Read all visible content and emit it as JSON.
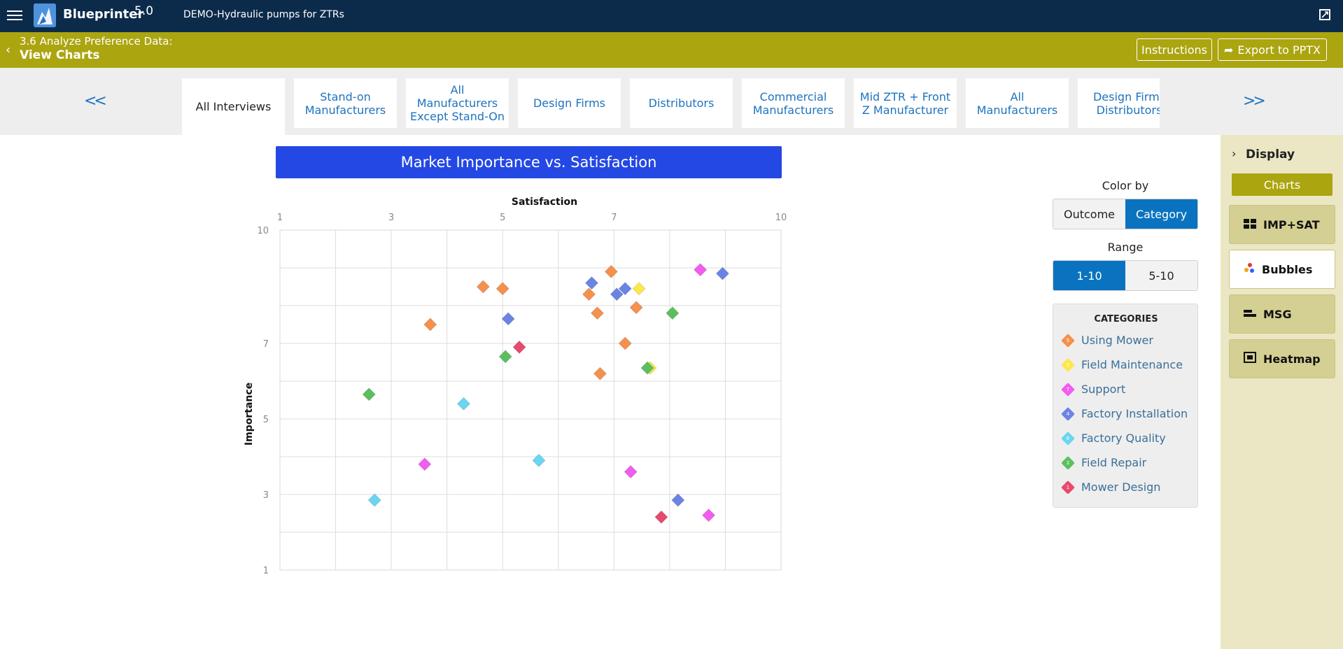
{
  "app": {
    "brand": "Blueprinter",
    "version": "5.0",
    "project": "DEMO-Hydraulic pumps for ZTRs"
  },
  "subheader": {
    "step": "3.6 Analyze Preference Data:",
    "title": "View Charts",
    "instructions_label": "Instructions",
    "export_label": "Export to PPTX"
  },
  "tabs": {
    "prev": "<<",
    "next": ">>",
    "items": [
      {
        "label": "All Interviews",
        "active": true
      },
      {
        "label": "Stand-on Manufacturers",
        "active": false
      },
      {
        "label": "All Manufacturers Except Stand-On",
        "active": false
      },
      {
        "label": "Design Firms",
        "active": false
      },
      {
        "label": "Distributors",
        "active": false
      },
      {
        "label": "Commercial Manufacturers",
        "active": false
      },
      {
        "label": "Mid ZTR + Front Z Manufacturer",
        "active": false
      },
      {
        "label": "All Manufacturers",
        "active": false
      },
      {
        "label": "Design Firms Distributors",
        "active": false
      }
    ]
  },
  "controls": {
    "color_by_label": "Color by",
    "color_by_options": [
      "Outcome",
      "Category"
    ],
    "color_by_selected": "Category",
    "range_label": "Range",
    "range_options": [
      "1-10",
      "5-10"
    ],
    "range_selected": "1-10",
    "categories_heading": "CATEGORIES"
  },
  "categories": [
    {
      "num": "5",
      "name": "Using Mower",
      "color": "#f5904d"
    },
    {
      "num": "3",
      "name": "Field Maintenance",
      "color": "#fde84a"
    },
    {
      "num": "7",
      "name": "Support",
      "color": "#f25cf0"
    },
    {
      "num": "4",
      "name": "Factory Installation",
      "color": "#6b84e4"
    },
    {
      "num": "6",
      "name": "Factory Quality",
      "color": "#6ad6f2"
    },
    {
      "num": "2",
      "name": "Field Repair",
      "color": "#5cbf5f"
    },
    {
      "num": "1",
      "name": "Mower Design",
      "color": "#e84a6e"
    }
  ],
  "sidebar": {
    "display_label": "Display",
    "charts_label": "Charts",
    "buttons": [
      {
        "label": "IMP+SAT",
        "icon": "imp-sat-icon",
        "selected": false
      },
      {
        "label": "Bubbles",
        "icon": "bubbles-icon",
        "selected": true
      },
      {
        "label": "MSG",
        "icon": "msg-icon",
        "selected": false
      },
      {
        "label": "Heatmap",
        "icon": "heatmap-icon",
        "selected": false
      }
    ]
  },
  "chart_data": {
    "type": "scatter",
    "title": "Market Importance vs. Satisfaction",
    "xlabel": "Satisfaction",
    "ylabel": "Importance",
    "xlim": [
      1,
      10
    ],
    "ylim": [
      1,
      10
    ],
    "xticks": [
      1,
      3,
      5,
      7,
      10
    ],
    "yticks": [
      1,
      3,
      5,
      7,
      10
    ],
    "grid": true,
    "points": [
      {
        "x": 4.65,
        "y": 8.5,
        "cat": "Using Mower"
      },
      {
        "x": 5.0,
        "y": 8.45,
        "cat": "Using Mower"
      },
      {
        "x": 3.7,
        "y": 7.5,
        "cat": "Using Mower"
      },
      {
        "x": 6.55,
        "y": 8.3,
        "cat": "Using Mower"
      },
      {
        "x": 6.95,
        "y": 8.9,
        "cat": "Using Mower"
      },
      {
        "x": 6.7,
        "y": 7.8,
        "cat": "Using Mower"
      },
      {
        "x": 7.4,
        "y": 7.95,
        "cat": "Using Mower"
      },
      {
        "x": 7.2,
        "y": 7.0,
        "cat": "Using Mower"
      },
      {
        "x": 6.75,
        "y": 6.2,
        "cat": "Using Mower"
      },
      {
        "x": 7.45,
        "y": 8.45,
        "cat": "Field Maintenance"
      },
      {
        "x": 7.65,
        "y": 6.35,
        "cat": "Field Maintenance"
      },
      {
        "x": 8.55,
        "y": 8.95,
        "cat": "Support"
      },
      {
        "x": 3.6,
        "y": 3.8,
        "cat": "Support"
      },
      {
        "x": 7.3,
        "y": 3.6,
        "cat": "Support"
      },
      {
        "x": 8.7,
        "y": 2.45,
        "cat": "Support"
      },
      {
        "x": 6.6,
        "y": 8.6,
        "cat": "Factory Installation"
      },
      {
        "x": 7.2,
        "y": 8.45,
        "cat": "Factory Installation"
      },
      {
        "x": 7.05,
        "y": 8.3,
        "cat": "Factory Installation"
      },
      {
        "x": 5.1,
        "y": 7.65,
        "cat": "Factory Installation"
      },
      {
        "x": 8.95,
        "y": 8.85,
        "cat": "Factory Installation"
      },
      {
        "x": 8.15,
        "y": 2.85,
        "cat": "Factory Installation"
      },
      {
        "x": 4.3,
        "y": 5.4,
        "cat": "Factory Quality"
      },
      {
        "x": 5.65,
        "y": 3.9,
        "cat": "Factory Quality"
      },
      {
        "x": 2.7,
        "y": 2.85,
        "cat": "Factory Quality"
      },
      {
        "x": 2.6,
        "y": 5.65,
        "cat": "Field Repair"
      },
      {
        "x": 5.05,
        "y": 6.65,
        "cat": "Field Repair"
      },
      {
        "x": 7.6,
        "y": 6.35,
        "cat": "Field Repair"
      },
      {
        "x": 8.05,
        "y": 7.8,
        "cat": "Field Repair"
      },
      {
        "x": 5.3,
        "y": 6.9,
        "cat": "Mower Design"
      },
      {
        "x": 7.85,
        "y": 2.4,
        "cat": "Mower Design"
      }
    ]
  }
}
